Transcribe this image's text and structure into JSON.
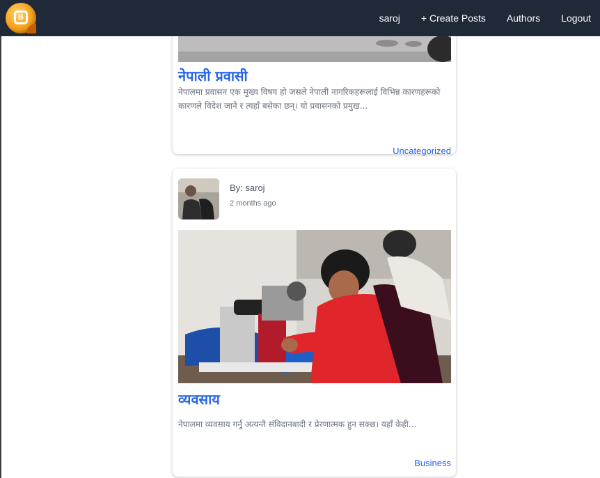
{
  "navbar": {
    "logo_icon": "blogger-logo-icon",
    "links": [
      {
        "label": "saroj"
      },
      {
        "label": "+ Create Posts"
      },
      {
        "label": "Authors"
      },
      {
        "label": "Logout"
      }
    ]
  },
  "posts": [
    {
      "title": "नेपाली प्रवासी",
      "excerpt": "नेपालमा प्रवासन एक मुख्य विषय हो जसले नेपाली नागरिकहरूलाई विभिन्न कारणहरूको कारणले विदेश जाने र त्यहाँ बसेका छन्। यो प्रवासनको प्रमुख...",
      "category": "Uncategorized"
    },
    {
      "author": "By: saroj",
      "time": "2 months ago",
      "title": "व्यवसाय",
      "excerpt": "नेपालमा व्यवसाय गर्नु अत्यन्तै संविदानबादी र प्रेरणात्मक हुन सक्छ। यहाँ केही...",
      "category": "Business"
    }
  ],
  "colors": {
    "navbar_bg": "#1f2937",
    "link_blue": "#2563eb"
  }
}
